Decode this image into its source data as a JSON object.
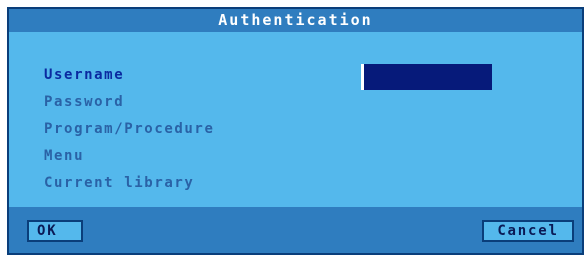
{
  "dialog": {
    "title": "Authentication",
    "fields": [
      {
        "label": "Username",
        "value": "",
        "active": true
      },
      {
        "label": "Password"
      },
      {
        "label": "Program/Procedure"
      },
      {
        "label": "Menu"
      },
      {
        "label": "Current library"
      }
    ],
    "buttons": {
      "ok_label": "OK",
      "cancel_label": "Cancel"
    }
  },
  "colors": {
    "panel": "#54b8ec",
    "titlebar": "#2f7dbf",
    "input_bg": "#061a7a",
    "label_active": "#0a2aa0",
    "label_inactive": "#2a62a6"
  }
}
